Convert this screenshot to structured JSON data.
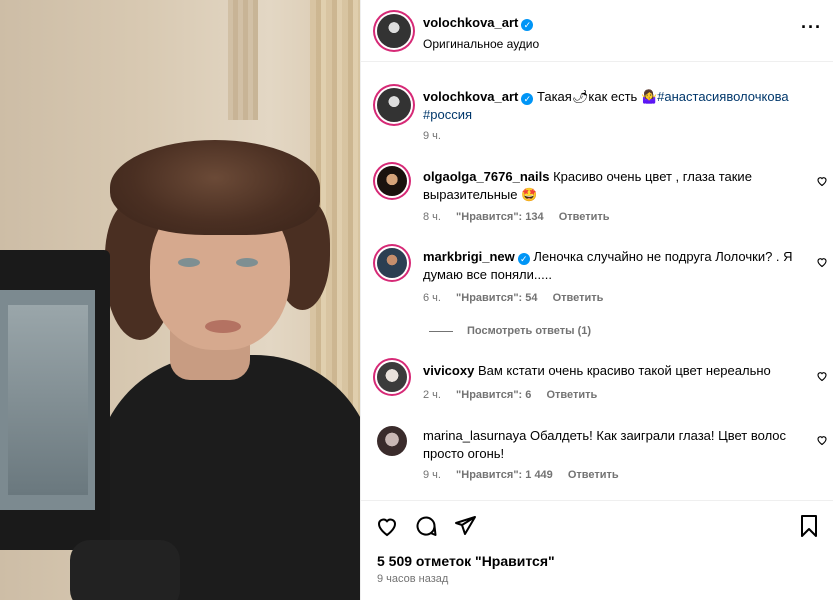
{
  "post": {
    "author": "volochkova_art",
    "audio": "Оригинальное аудио",
    "caption_prefix": "Такая",
    "caption_emoji1": "🌶",
    "caption_mid": "как есть",
    "caption_emoji2": "🤷‍♀️",
    "hashtag1": "#анастасияволочкова",
    "hashtag2": "#россия",
    "time": "9 ч."
  },
  "comments": [
    {
      "user": "olgaolga_7676_nails",
      "verified": false,
      "text": "Красиво очень цвет , глаза такие выразительные 🤩",
      "time": "8 ч.",
      "likes": "\"Нравится\": 134",
      "reply": "Ответить"
    },
    {
      "user": "markbrigi_new",
      "verified": true,
      "text": "Леночка случайно не подруга Лолочки? . Я думаю все поняли.....",
      "time": "6 ч.",
      "likes": "\"Нравится\": 54",
      "reply": "Ответить"
    },
    {
      "user": "vivicoxy",
      "verified": false,
      "text": "Вам кстати очень красиво такой цвет нереально",
      "time": "2 ч.",
      "likes": "\"Нравится\": 6",
      "reply": "Ответить"
    },
    {
      "user": "marina_lasurnaya",
      "verified": false,
      "text": "Обалдеть! Как заиграли глаза! Цвет волос просто огонь!",
      "time": "9 ч.",
      "likes": "\"Нравится\": 1 449",
      "reply": "Ответить"
    }
  ],
  "view_replies": "Посмотреть ответы (1)",
  "likes_total": "5 509 отметок \"Нравится\"",
  "posted_ago": "9 часов назад",
  "icons": [
    "heart-icon",
    "comment-icon",
    "share-icon",
    "bookmark-icon",
    "verified-icon",
    "more-icon"
  ],
  "colors": {
    "verified": "#0095f6",
    "hashtag": "#00376b",
    "muted": "#737373"
  }
}
